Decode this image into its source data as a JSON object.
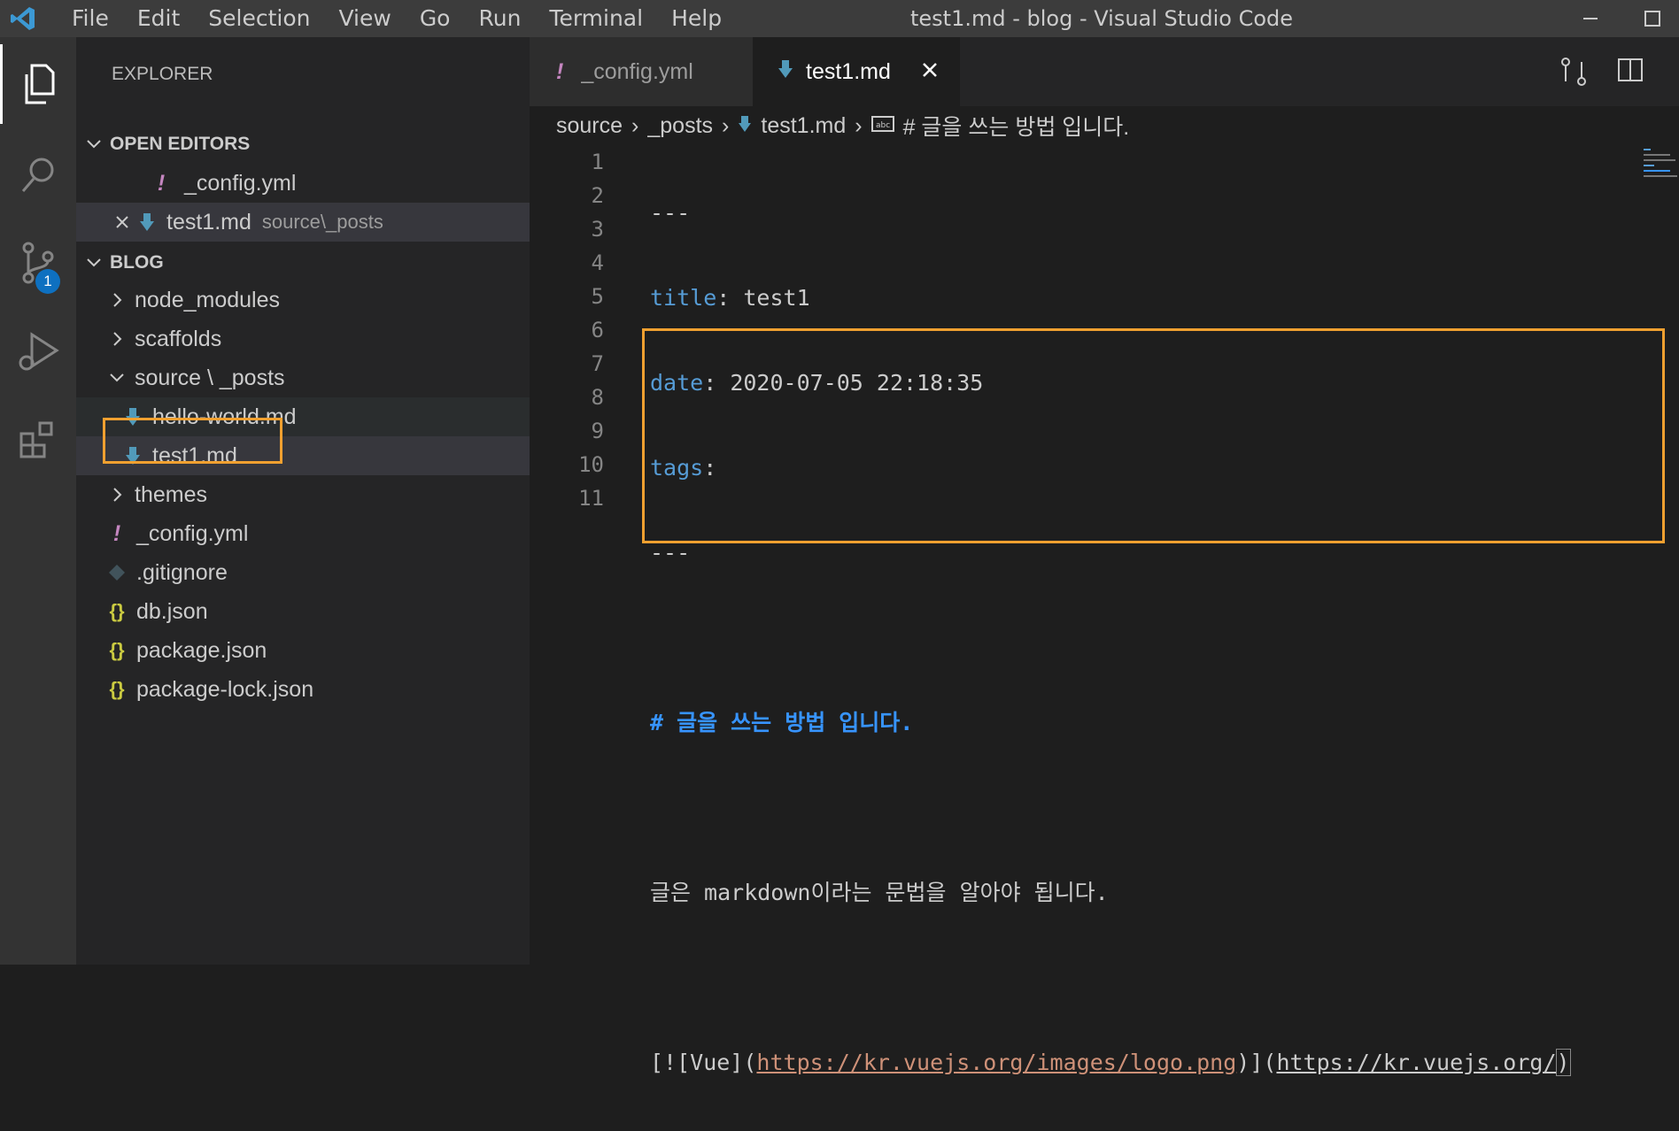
{
  "titlebar": {
    "menu": [
      "File",
      "Edit",
      "Selection",
      "View",
      "Go",
      "Run",
      "Terminal",
      "Help"
    ],
    "window_title": "test1.md - blog - Visual Studio Code"
  },
  "activitybar": {
    "items": [
      "explorer-icon",
      "search-icon",
      "source-control-icon",
      "run-debug-icon",
      "extensions-icon"
    ],
    "scm_badge": "1"
  },
  "sidebar": {
    "title": "EXPLORER",
    "open_editors": {
      "label": "OPEN EDITORS",
      "items": [
        {
          "name": "_config.yml",
          "desc": ""
        },
        {
          "name": "test1.md",
          "desc": "source\\_posts"
        }
      ]
    },
    "folder": {
      "label": "BLOG",
      "items": [
        {
          "name": "node_modules"
        },
        {
          "name": "scaffolds"
        },
        {
          "name": "source \\ _posts"
        },
        {
          "name": "hello-world.md"
        },
        {
          "name": "test1.md"
        },
        {
          "name": "themes"
        },
        {
          "name": "_config.yml"
        },
        {
          "name": ".gitignore"
        },
        {
          "name": "db.json"
        },
        {
          "name": "package.json"
        },
        {
          "name": "package-lock.json"
        }
      ]
    }
  },
  "tabs": [
    {
      "label": "_config.yml",
      "active": false
    },
    {
      "label": "test1.md",
      "active": true
    }
  ],
  "breadcrumb": [
    "source",
    "_posts",
    "test1.md",
    "# 글을 쓰는 방법 입니다."
  ],
  "editor": {
    "line_numbers": [
      "1",
      "2",
      "3",
      "4",
      "5",
      "6",
      "7",
      "8",
      "9",
      "10",
      "11"
    ],
    "lines": {
      "l1": "---",
      "l2_key": "title",
      "l2_val": " test1",
      "l3_key": "date",
      "l3_val": " 2020-07-05 22:18:35",
      "l4_key": "tags",
      "l5": "---",
      "l7": "# 글을 쓰는 방법 입니다.",
      "l9": "글은 markdown이라는 문법을 알아야 됩니다.",
      "l11_open": "[![Vue](",
      "l11_img_url": "https://kr.vuejs.org/images/logo.png",
      "l11_mid": ")](",
      "l11_url": "https://kr.vuejs.org/",
      "l11_close": ")"
    }
  },
  "colors": {
    "accent_box": "#f0a030",
    "heading": "#3794ff",
    "yaml_key": "#569cd6",
    "link": "#ce9178"
  }
}
